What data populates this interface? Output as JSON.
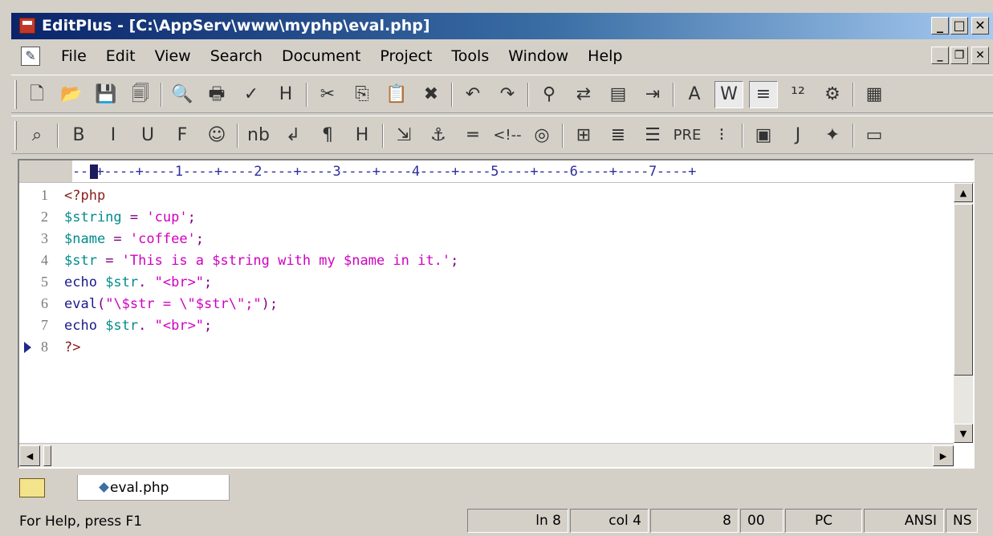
{
  "window": {
    "title": "EditPlus - [C:\\AppServ\\www\\myphp\\eval.php]",
    "minimize": "_",
    "maximize": "□",
    "close": "✕"
  },
  "menu": {
    "items": [
      "File",
      "Edit",
      "View",
      "Search",
      "Document",
      "Project",
      "Tools",
      "Window",
      "Help"
    ],
    "doc_minimize": "_",
    "doc_restore": "❐",
    "doc_close": "✕"
  },
  "toolbar1": {
    "buttons": [
      {
        "name": "new-file-icon",
        "glyph": "🗋"
      },
      {
        "name": "open-folder-icon",
        "glyph": "📂"
      },
      {
        "name": "save-icon",
        "glyph": "💾"
      },
      {
        "name": "save-all-icon",
        "glyph": "🗐"
      },
      {
        "name": "print-preview-icon",
        "glyph": "🔍"
      },
      {
        "name": "print-icon",
        "glyph": "🖶"
      },
      {
        "name": "spell-check-icon",
        "glyph": "✓"
      },
      {
        "name": "html-preview-icon",
        "glyph": "H"
      },
      {
        "name": "cut-icon",
        "glyph": "✂"
      },
      {
        "name": "copy-icon",
        "glyph": "⎘"
      },
      {
        "name": "paste-icon",
        "glyph": "📋"
      },
      {
        "name": "delete-icon",
        "glyph": "✖"
      },
      {
        "name": "undo-icon",
        "glyph": "↶"
      },
      {
        "name": "redo-icon",
        "glyph": "↷"
      },
      {
        "name": "find-icon",
        "glyph": "⚲"
      },
      {
        "name": "replace-icon",
        "glyph": "⇄"
      },
      {
        "name": "clipboard-icon",
        "glyph": "▤"
      },
      {
        "name": "indent-icon",
        "glyph": "⇥"
      },
      {
        "name": "font-icon",
        "glyph": "A"
      },
      {
        "name": "word-wrap-icon",
        "glyph": "W"
      },
      {
        "name": "line-icon",
        "glyph": "≡"
      },
      {
        "name": "line-numbers-icon",
        "glyph": "¹²"
      },
      {
        "name": "preferences-icon",
        "glyph": "⚙"
      },
      {
        "name": "cliptext-icon",
        "glyph": "▦"
      }
    ]
  },
  "toolbar2": {
    "buttons": [
      {
        "name": "browser-icon",
        "glyph": "⌕"
      },
      {
        "name": "bold-icon",
        "glyph": "B"
      },
      {
        "name": "italic-icon",
        "glyph": "I"
      },
      {
        "name": "underline-icon",
        "glyph": "U"
      },
      {
        "name": "font-tag-icon",
        "glyph": "F"
      },
      {
        "name": "color-icon",
        "glyph": "☺"
      },
      {
        "name": "nbsp-icon",
        "glyph": "nb"
      },
      {
        "name": "line-break-icon",
        "glyph": "↲"
      },
      {
        "name": "paragraph-icon",
        "glyph": "¶"
      },
      {
        "name": "heading-icon",
        "glyph": "H"
      },
      {
        "name": "link-icon",
        "glyph": "⇲"
      },
      {
        "name": "anchor-icon",
        "glyph": "⚓"
      },
      {
        "name": "horizontal-rule-icon",
        "glyph": "═"
      },
      {
        "name": "comment-icon",
        "glyph": "<!--"
      },
      {
        "name": "image-icon",
        "glyph": "◎"
      },
      {
        "name": "table-icon",
        "glyph": "⊞"
      },
      {
        "name": "center-icon",
        "glyph": "≣"
      },
      {
        "name": "align-right-icon",
        "glyph": "☰"
      },
      {
        "name": "pre-icon",
        "glyph": "PRE"
      },
      {
        "name": "list-icon",
        "glyph": "⁝"
      },
      {
        "name": "form-icon",
        "glyph": "▣"
      },
      {
        "name": "javascript-icon",
        "glyph": "J"
      },
      {
        "name": "toolbar-more-icon",
        "glyph": "✦"
      },
      {
        "name": "file-window-icon",
        "glyph": "▭"
      }
    ]
  },
  "ruler": {
    "text": "---+----+----1----+----2----+----3----+----4----+----5----+----6----+----7----+"
  },
  "code": {
    "lines": [
      {
        "num": "1",
        "tokens": [
          [
            "tag",
            "<?php"
          ]
        ]
      },
      {
        "num": "2",
        "tokens": [
          [
            "var",
            "$string"
          ],
          [
            "op",
            " = "
          ],
          [
            "str",
            "'cup'"
          ],
          [
            "op",
            ";"
          ]
        ]
      },
      {
        "num": "3",
        "tokens": [
          [
            "var",
            "$name"
          ],
          [
            "op",
            " = "
          ],
          [
            "str",
            "'coffee'"
          ],
          [
            "op",
            ";"
          ]
        ]
      },
      {
        "num": "4",
        "tokens": [
          [
            "var",
            "$str"
          ],
          [
            "op",
            " = "
          ],
          [
            "str",
            "'This is a $string with my $name in it.'"
          ],
          [
            "op",
            ";"
          ]
        ]
      },
      {
        "num": "5",
        "tokens": [
          [
            "kw",
            "echo "
          ],
          [
            "var",
            "$str"
          ],
          [
            "op",
            ". "
          ],
          [
            "str",
            "\"<br>\""
          ],
          [
            "op",
            ";"
          ]
        ]
      },
      {
        "num": "6",
        "tokens": [
          [
            "kw",
            "eval"
          ],
          [
            "op",
            "("
          ],
          [
            "str",
            "\"\\$str = \\\"$str\\\";\""
          ],
          [
            "op",
            ");"
          ]
        ]
      },
      {
        "num": "7",
        "tokens": [
          [
            "kw",
            "echo "
          ],
          [
            "var",
            "$str"
          ],
          [
            "op",
            ". "
          ],
          [
            "str",
            "\"<br>\""
          ],
          [
            "op",
            ";"
          ]
        ]
      },
      {
        "num": "8",
        "tokens": [
          [
            "tag",
            "?>"
          ]
        ],
        "current": true
      }
    ]
  },
  "tabs": {
    "active": "eval.php"
  },
  "status": {
    "help": "For Help, press F1",
    "ln": "ln 8",
    "col": "col 4",
    "chars": "8",
    "code": "00",
    "format": "PC",
    "encoding": "ANSI",
    "mode": "NS"
  },
  "colors": {
    "titlebar": "#0a246a",
    "var": "#008b8b",
    "string": "#d000c0",
    "keyword": "#1a1a8a"
  }
}
